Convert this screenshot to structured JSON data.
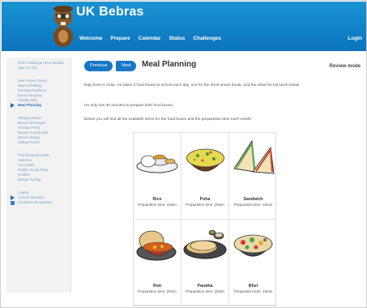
{
  "header": {
    "site_title": "UK Bebras",
    "nav": [
      "Welcome",
      "Prepare",
      "Calendar",
      "Status",
      "Challenges"
    ],
    "login": "Login"
  },
  "sidebar": {
    "groups": [
      [
        "2020 Challenge (Intermediate (age 12-14))"
      ],
      [
        "Best Placed Tennis",
        "Bayes Ranking",
        "Farming Problems",
        "Binary Merging",
        "Paintbuckets",
        "Meal Planning"
      ],
      [
        "Shaping Moves",
        "Beaver Messages",
        "Treasure Path",
        "Beaver Scoreboard",
        "Beaver Bridge",
        "Sliding Puzzle"
      ],
      [
        "Friendship Bracelets",
        "Switches",
        "Accessible",
        "Rubble Route Drive",
        "Gridline",
        "Beaver Sorting"
      ]
    ],
    "current_item": "Meal Planning",
    "footer_links": [
      "Logout",
      "Current Question",
      "Unanswered Question"
    ]
  },
  "main": {
    "prev_label": "Previous",
    "next_label": "Next",
    "title": "Meal Planning",
    "review_mode": "Review mode",
    "paragraphs": [
      "Raju lives in India. He takes 2 food boxes to school each day, one for the short snack break, and the other for his lunch break.",
      "He only has 30 minutes to prepare both food boxes.",
      "Below you will find all the available items for the food boxes and the preparation time each needs:"
    ],
    "foods": [
      {
        "name": "Rice",
        "prep": "Preparation time: 10min",
        "icon": "rice-bowl-icon"
      },
      {
        "name": "Poha",
        "prep": "Preparation time: 20min",
        "icon": "poha-bowl-icon"
      },
      {
        "name": "Sandwich",
        "prep": "Preparation time: 10min",
        "icon": "sandwich-icon"
      },
      {
        "name": "Roti",
        "prep": "Preparation time: 20min",
        "icon": "roti-curry-icon"
      },
      {
        "name": "Paratha",
        "prep": "Preparation time: 20min",
        "icon": "paratha-plate-icon"
      },
      {
        "name": "Bhel",
        "prep": "Preparation time: 10min",
        "icon": "bhel-bowl-icon"
      }
    ]
  }
}
